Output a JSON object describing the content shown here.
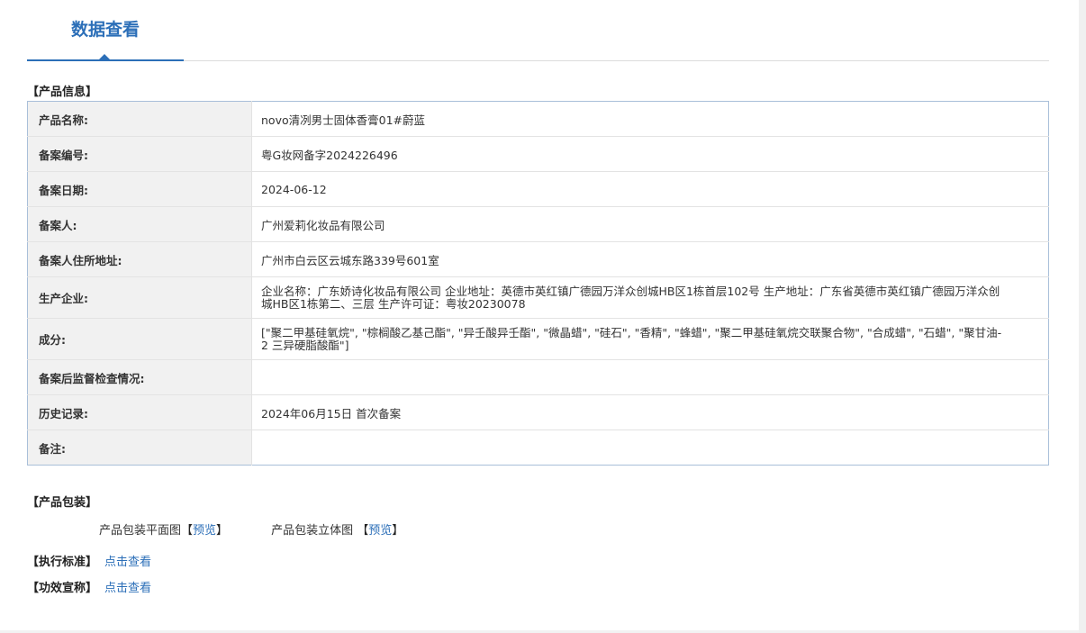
{
  "tab": {
    "title": "数据查看"
  },
  "product_info": {
    "section_title": "【产品信息】",
    "rows": [
      {
        "label": "产品名称:",
        "value": "novo清冽男士固体香膏01#蔚蓝"
      },
      {
        "label": "备案编号:",
        "value": "粤G妆网备字2024226496"
      },
      {
        "label": "备案日期:",
        "value": "2024-06-12"
      },
      {
        "label": "备案人:",
        "value": "广州爱莉化妆品有限公司"
      },
      {
        "label": "备案人住所地址:",
        "value": "广州市白云区云城东路339号601室"
      },
      {
        "label": "生产企业:",
        "value": "企业名称：广东娇诗化妆品有限公司 企业地址：英德市英红镇广德园万洋众创城HB区1栋首层102号 生产地址：广东省英德市英红镇广德园万洋众创城HB区1栋第二、三层 生产许可证：粤妆20230078"
      },
      {
        "label": "成分:",
        "value": "[\"聚二甲基硅氧烷\", \"棕榈酸乙基己酯\", \"异壬酸异壬酯\", \"微晶蜡\", \"硅石\", \"香精\", \"蜂蜡\", \"聚二甲基硅氧烷交联聚合物\", \"合成蜡\", \"石蜡\", \"聚甘油-2 三异硬脂酸酯\"]"
      },
      {
        "label": "备案后监督检查情况:",
        "value": ""
      },
      {
        "label": "历史记录:",
        "value": "2024年06月15日 首次备案"
      },
      {
        "label": "备注:",
        "value": ""
      }
    ]
  },
  "packaging": {
    "section_title": "【产品包装】",
    "flat_label": "产品包装平面图",
    "flat_link": "预览",
    "stereo_label": "产品包装立体图",
    "stereo_link": "预览",
    "bracket_open": "【",
    "bracket_close": "】"
  },
  "standard": {
    "section_title": "【执行标准】",
    "link": "点击查看"
  },
  "efficacy": {
    "section_title": "【功效宣称】",
    "link": "点击查看"
  },
  "colors": {
    "accent": "#2c6fb8",
    "label_bg": "#f1f1f1",
    "table_border": "#a9bfd9"
  }
}
